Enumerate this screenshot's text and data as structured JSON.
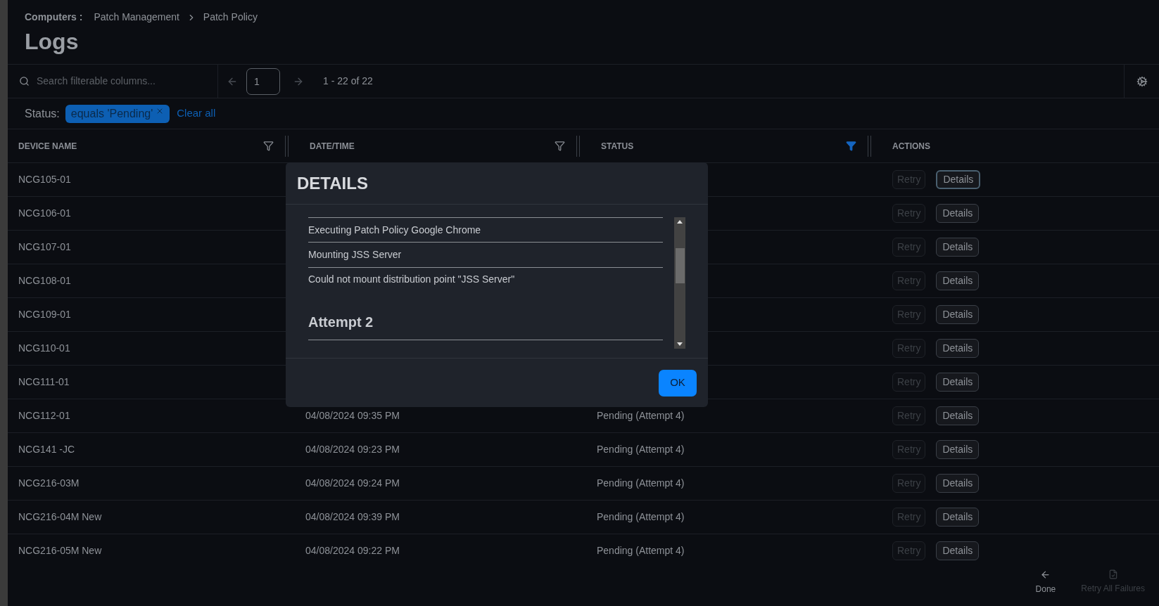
{
  "breadcrumb": {
    "section": "Computers :",
    "items": [
      "Patch Management",
      "Patch Policy"
    ]
  },
  "title": "Logs",
  "toolbar": {
    "search_placeholder": "Search filterable columns...",
    "page": "1",
    "range": "1 - 22 of 22"
  },
  "filters": {
    "label": "Status:",
    "chips": [
      "equals 'Pending'"
    ],
    "clear": "Clear all"
  },
  "columns": [
    {
      "label": "DEVICE NAME",
      "kind": "filterable",
      "filter_active": false
    },
    {
      "label": "DATE/TIME",
      "kind": "filterable",
      "filter_active": false
    },
    {
      "label": "STATUS",
      "kind": "filterable",
      "filter_active": true
    },
    {
      "label": "ACTIONS",
      "kind": "plain"
    }
  ],
  "rows": [
    {
      "device": "NCG105-01",
      "retry": "Retry",
      "retry_disabled": true,
      "details": "Details",
      "focused": true
    },
    {
      "device": "NCG106-01",
      "retry": "Retry",
      "retry_disabled": true,
      "details": "Details",
      "focused": false
    },
    {
      "device": "NCG107-01",
      "retry": "Retry",
      "retry_disabled": true,
      "details": "Details",
      "focused": false
    },
    {
      "device": "NCG108-01",
      "retry": "Retry",
      "retry_disabled": true,
      "details": "Details",
      "focused": false
    },
    {
      "device": "NCG109-01",
      "retry": "Retry",
      "retry_disabled": true,
      "details": "Details",
      "focused": false
    },
    {
      "device": "NCG110-01",
      "retry": "Retry",
      "retry_disabled": true,
      "details": "Details",
      "focused": false
    },
    {
      "device": "NCG111-01",
      "retry": "Retry",
      "retry_disabled": true,
      "details": "Details",
      "focused": false
    },
    {
      "device": "NCG112-01",
      "date": "04/08/2024 09:35 PM",
      "status": "Pending (Attempt 4)",
      "retry": "Retry",
      "retry_disabled": true,
      "details": "Details",
      "focused": false
    },
    {
      "device": "NCG141 -JC",
      "date": "04/08/2024 09:23 PM",
      "status": "Pending (Attempt 4)",
      "retry": "Retry",
      "retry_disabled": true,
      "details": "Details",
      "focused": false
    },
    {
      "device": "NCG216-03M",
      "date": "04/08/2024 09:24 PM",
      "status": "Pending (Attempt 4)",
      "retry": "Retry",
      "retry_disabled": true,
      "details": "Details",
      "focused": false
    },
    {
      "device": "NCG216-04M New",
      "date": "04/08/2024 09:39 PM",
      "status": "Pending (Attempt 4)",
      "retry": "Retry",
      "retry_disabled": true,
      "details": "Details",
      "focused": false
    },
    {
      "device": "NCG216-05M New",
      "date": "04/08/2024 09:22 PM",
      "status": "Pending (Attempt 4)",
      "retry": "Retry",
      "retry_disabled": true,
      "details": "Details",
      "focused": false
    }
  ],
  "footer": [
    {
      "label": "Done",
      "kind": "back",
      "disabled": false
    },
    {
      "label": "Retry All Failures",
      "kind": "retry",
      "disabled": true
    }
  ],
  "modal": {
    "title": "DETAILS",
    "entries": [
      {
        "kind": "line",
        "text": "Executing Patch Policy Google Chrome"
      },
      {
        "kind": "line",
        "text": "Mounting JSS Server"
      },
      {
        "kind": "line",
        "text": "Could not mount distribution point \"JSS Server\""
      },
      {
        "kind": "heading",
        "text": "Attempt 2"
      }
    ],
    "ok": "OK"
  }
}
